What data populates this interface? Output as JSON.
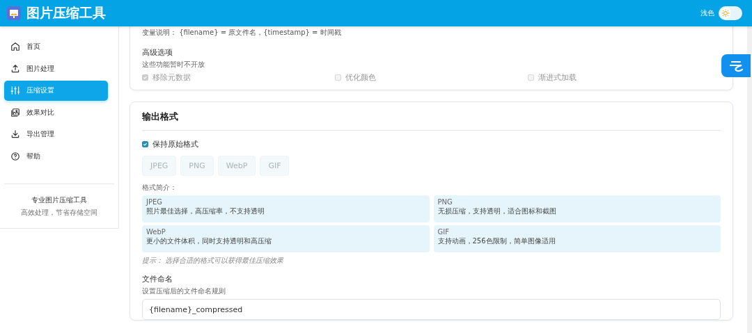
{
  "app": {
    "title": "图片压缩工具"
  },
  "theme_toggle": {
    "label": "浅色",
    "dark": false
  },
  "sidebar": {
    "items": [
      {
        "label": "首页",
        "selected": false
      },
      {
        "label": "图片处理",
        "selected": false
      },
      {
        "label": "压缩设置",
        "selected": true
      },
      {
        "label": "效果对比",
        "selected": false
      },
      {
        "label": "导出管理",
        "selected": false
      },
      {
        "label": "帮助",
        "selected": false
      }
    ],
    "footer": {
      "title": "专业图片压缩工具",
      "subtitle": "高效处理，节省存储空间"
    }
  },
  "naming_hint": "变量说明： {filename} = 原文件名，{timestamp} = 时间戳",
  "advanced": {
    "title": "高级选项",
    "subtitle": "这些功能暂时不开放",
    "options": [
      {
        "label": "移除元数据",
        "checked": true,
        "disabled": true
      },
      {
        "label": "优化颜色",
        "checked": false,
        "disabled": true
      },
      {
        "label": "渐进式加载",
        "checked": false,
        "disabled": true
      }
    ]
  },
  "output": {
    "title": "输出格式",
    "keep_original": {
      "label": "保持原始格式",
      "checked": true
    },
    "formats": [
      {
        "label": "JPEG",
        "disabled": true
      },
      {
        "label": "PNG",
        "disabled": true
      },
      {
        "label": "WebP",
        "disabled": true
      },
      {
        "label": "GIF",
        "disabled": true
      }
    ],
    "intro_label": "格式简介：",
    "intros": [
      {
        "name": "JPEG",
        "text": "照片最佳选择，高压缩率，不支持透明"
      },
      {
        "name": "PNG",
        "text": "无损压缩，支持透明，适合图标和截图"
      },
      {
        "name": "WebP",
        "text": "更小的文件体积，同时支持透明和高压缩"
      },
      {
        "name": "GIF",
        "text": "支持动画，256色限制，简单图像适用"
      }
    ],
    "tip": "提示： 选择合适的格式可以获得最佳压缩效果"
  },
  "file_naming": {
    "title": "文件命名",
    "subtitle": "设置压缩后的文件命名规则",
    "value": "{filename}_compressed"
  }
}
